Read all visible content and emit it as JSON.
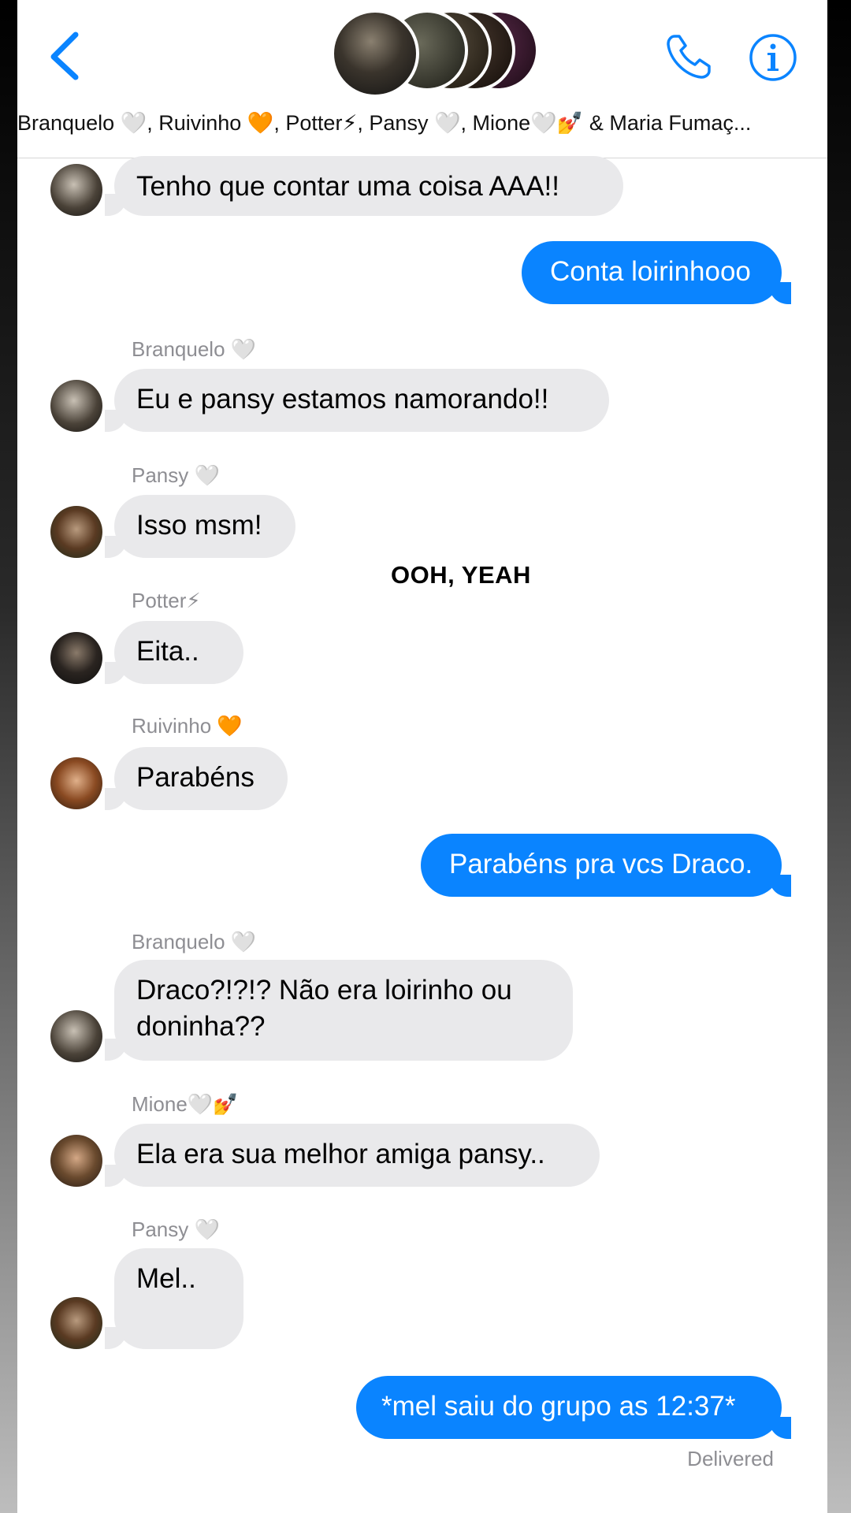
{
  "header": {
    "members": "Branquelo 🤍, Ruivinho 🧡, Potter⚡, Pansy 🤍, Mione🤍💅 & Maria Fumaç..."
  },
  "overlay": "OOH, YEAH",
  "messages": {
    "m1": "Tenho que contar uma coisa AAA!!",
    "m2": "Conta loirinhooo",
    "s3": "Branquelo 🤍",
    "m3": "Eu e pansy estamos namorando!!",
    "s4": "Pansy 🤍",
    "m4": "Isso msm!",
    "s5": "Potter⚡",
    "m5": "Eita..",
    "s6": "Ruivinho 🧡",
    "m6": "Parabéns",
    "m7": "Parabéns pra vcs Draco.",
    "s8": "Branquelo 🤍",
    "m8": "Draco?!?!? Não era loirinho ou doninha??",
    "s9": "Mione🤍💅",
    "m9": "Ela era sua melhor amiga pansy..",
    "s10": "Pansy 🤍",
    "m10": "Mel..",
    "m11": "*mel saiu do grupo as 12:37*"
  },
  "status": "Delivered",
  "colors": {
    "accent": "#0a84ff",
    "incoming": "#e9e9eb"
  }
}
